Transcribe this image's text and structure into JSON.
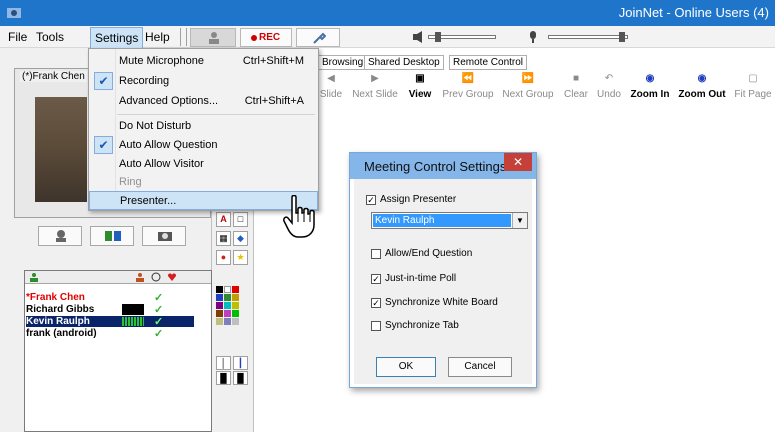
{
  "window": {
    "title": "JoinNet - Online Users (4)"
  },
  "menubar": {
    "items": [
      "File",
      "Tools",
      "Settings",
      "Help"
    ]
  },
  "toolbar": {
    "rec_label": "REC"
  },
  "settings_menu": {
    "items": [
      {
        "label": "Mute Microphone",
        "shortcut": "Ctrl+Shift+M",
        "checked": false
      },
      {
        "label": "Recording",
        "shortcut": "",
        "checked": true
      },
      {
        "label": "Advanced Options...",
        "shortcut": "Ctrl+Shift+A",
        "checked": false
      },
      {
        "label": "Do Not Disturb",
        "shortcut": "",
        "checked": false
      },
      {
        "label": "Auto Allow Question",
        "shortcut": "",
        "checked": true
      },
      {
        "label": "Auto Allow Visitor",
        "shortcut": "",
        "checked": false
      },
      {
        "label": "Ring",
        "shortcut": "",
        "checked": false,
        "disabled": true
      },
      {
        "label": "Presenter...",
        "shortcut": "",
        "checked": false,
        "highlighted": true
      }
    ]
  },
  "video": {
    "name": "(*)Frank Chen"
  },
  "tabs": [
    "Browsing",
    "Shared Desktop",
    "Remote Control"
  ],
  "nav_buttons": [
    {
      "label": "Slide",
      "active": false
    },
    {
      "label": "Next Slide",
      "active": false
    },
    {
      "label": "View",
      "active": true
    },
    {
      "label": "Prev Group",
      "active": false
    },
    {
      "label": "Next Group",
      "active": false
    },
    {
      "label": "Clear",
      "active": false
    },
    {
      "label": "Undo",
      "active": false
    },
    {
      "label": "Zoom In",
      "active": true
    },
    {
      "label": "Zoom Out",
      "active": true
    },
    {
      "label": "Fit Page",
      "active": false
    }
  ],
  "users": [
    {
      "name": "*Frank Chen",
      "color": "#e00000",
      "selected": false
    },
    {
      "name": "Richard Gibbs",
      "color": "#000000",
      "selected": false
    },
    {
      "name": "Kevin Raulph",
      "color": "#ffffff",
      "selected": true
    },
    {
      "name": "frank (android)",
      "color": "#000000",
      "selected": false
    }
  ],
  "dialog": {
    "title": "Meeting Control Settings",
    "close_label": "✕",
    "assign_presenter_label": "Assign Presenter",
    "assign_presenter_checked": true,
    "presenter_value": "Kevin Raulph",
    "options": [
      {
        "label": "Allow/End Question",
        "checked": false
      },
      {
        "label": "Just-in-time Poll",
        "checked": true
      },
      {
        "label": "Synchronize White Board",
        "checked": true
      },
      {
        "label": "Synchronize Tab",
        "checked": false
      }
    ],
    "ok_label": "OK",
    "cancel_label": "Cancel"
  },
  "colors": {
    "titlebar": "#1f75c9",
    "dialog_titlebar": "#85b6e9",
    "close_red": "#c6403a",
    "selection_blue": "#3399ff",
    "menu_highlight": "#cde4f7"
  }
}
